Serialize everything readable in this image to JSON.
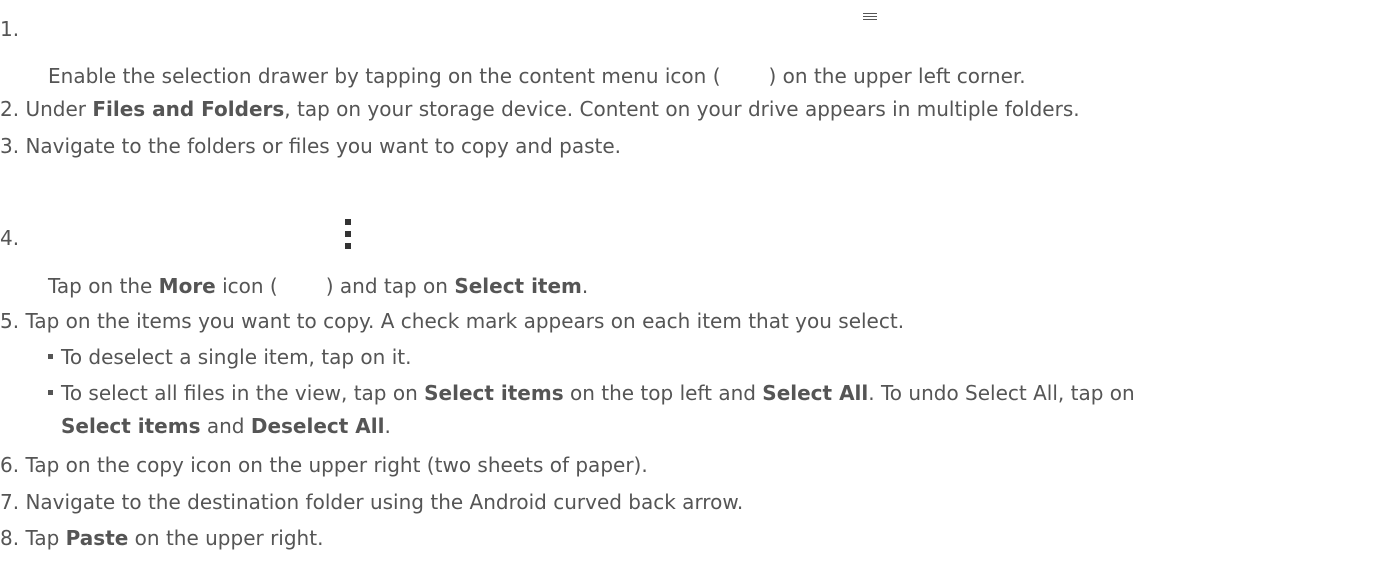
{
  "steps": [
    {
      "number": "1.",
      "text": "Enable the selection drawer by tapping on the content menu icon (",
      "text_after": ") on the upper left corner."
    },
    {
      "number": "2.",
      "text_before": "Under ",
      "bold": "Files and Folders",
      "text_after": ", tap on your storage device. Content on your drive appears in multiple folders."
    },
    {
      "number": "3.",
      "text": "Navigate to the folders or files you want to copy and paste."
    },
    {
      "number": "4.",
      "text_before": "Tap on the ",
      "bold": "More",
      "text_middle": " icon (",
      "text_middle2": ") and tap on ",
      "bold2": "Select item",
      "text_after": "."
    },
    {
      "number": "5.",
      "text": "Tap on the items you want to copy. A check mark appears on each item that you select.",
      "sub": [
        {
          "text": "To deselect a single item, tap on it."
        },
        {
          "text_before": "To select all files in the view, tap on ",
          "bold": "Select items",
          "text_middle": " on the top left and ",
          "bold2": "Select All",
          "text_after": ". To undo Select All, tap on",
          "bold3": "Select items",
          "text_middle2": " and ",
          "bold4": "Deselect All",
          "text_end": "."
        }
      ]
    },
    {
      "number": "6.",
      "text": "Tap on the copy icon on the upper right (two sheets of paper)."
    },
    {
      "number": "7.",
      "text": "Navigate to the destination folder using the Android curved back arrow."
    },
    {
      "number": "8.",
      "text_before": "Tap ",
      "bold": "Paste",
      "text_after": " on the upper right."
    }
  ],
  "icons": {
    "menu": "menu-icon",
    "more": "more-vertical-icon"
  }
}
